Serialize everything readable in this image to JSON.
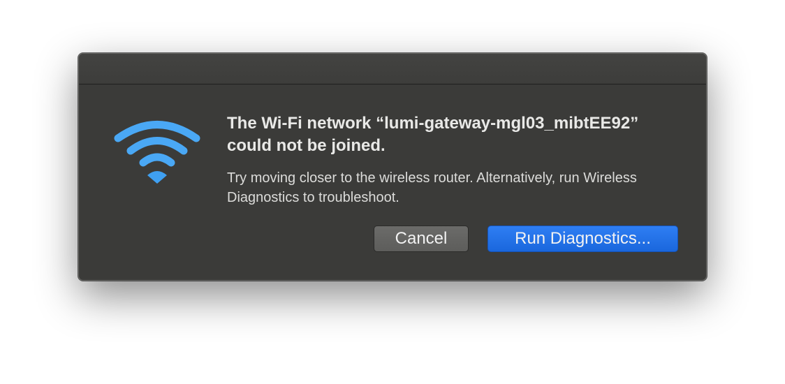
{
  "dialog": {
    "title": "The Wi-Fi network “lumi-gateway-mgl03_mibtEE92” could not be joined.",
    "message": "Try moving closer to the wireless router. Alternatively, run Wireless Diagnostics to troubleshoot.",
    "icon": "wifi-icon",
    "accent_color": "#4aa8f5",
    "buttons": {
      "cancel_label": "Cancel",
      "run_label": "Run Diagnostics..."
    }
  }
}
